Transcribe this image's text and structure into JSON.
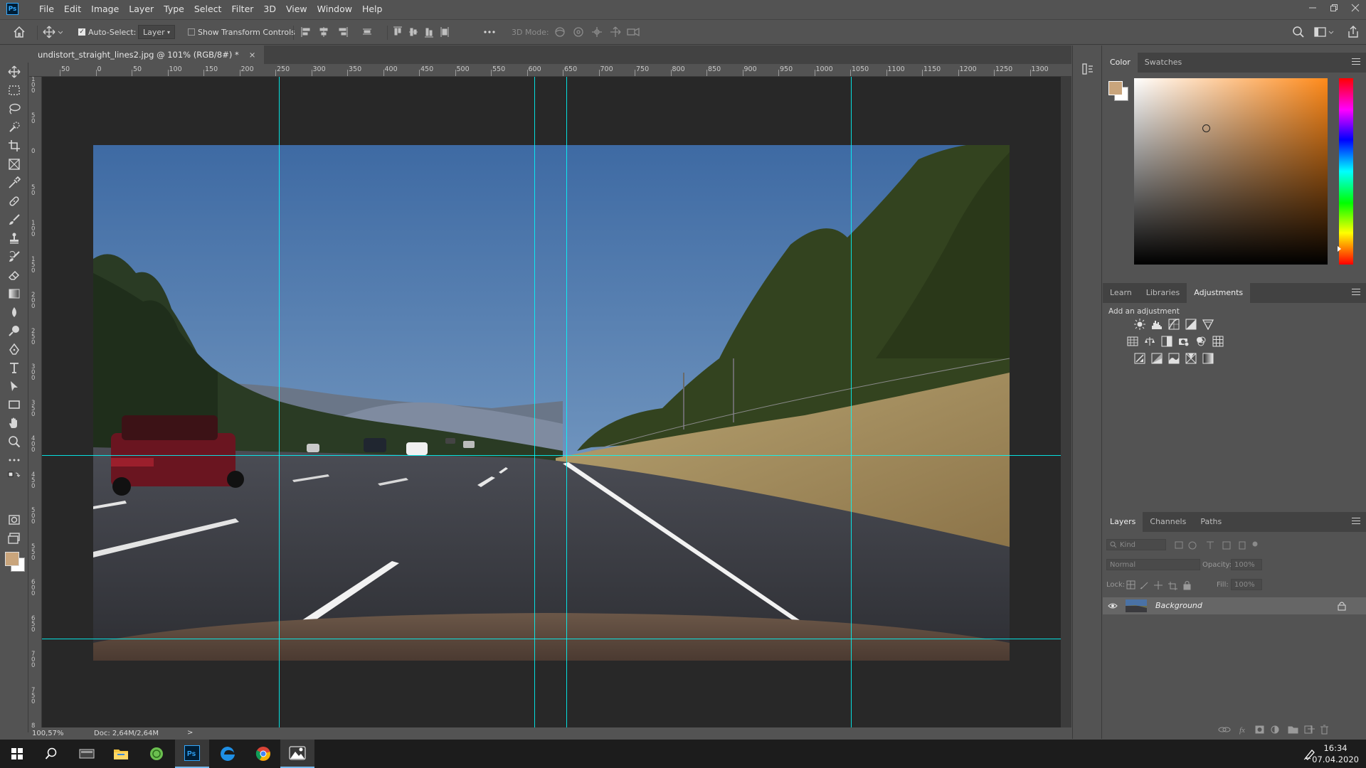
{
  "app": {
    "logo_text": "Ps"
  },
  "menu": [
    "File",
    "Edit",
    "Image",
    "Layer",
    "Type",
    "Select",
    "Filter",
    "3D",
    "View",
    "Window",
    "Help"
  ],
  "options_bar": {
    "auto_select_label": "Auto-Select:",
    "auto_select_checked": true,
    "auto_select_target": "Layer",
    "show_transform_label": "Show Transform Controls",
    "mode_3d_label": "3D Mode:"
  },
  "document": {
    "tab_title": "undistort_straight_lines2.jpg @ 101% (RGB/8#) *",
    "close_glyph": "×",
    "ruler_h_labels": [
      "50",
      "0",
      "50",
      "100",
      "150",
      "200",
      "250",
      "300",
      "350",
      "400",
      "450",
      "500",
      "550",
      "600",
      "650",
      "700",
      "750",
      "800",
      "850",
      "900",
      "950",
      "1000",
      "1050",
      "1100",
      "1150",
      "1200",
      "1250",
      "1300"
    ],
    "ruler_v_labels": [
      "1 0 0",
      "5 0",
      "0",
      "5 0",
      "1 0 0",
      "1 5 0",
      "2 0 0",
      "2 5 0",
      "3 0 0",
      "3 5 0",
      "4 0 0",
      "4 5 0",
      "5 0 0",
      "5 5 0",
      "6 0 0",
      "6 5 0",
      "7 0 0",
      "7 5 0",
      "8"
    ]
  },
  "status": {
    "zoom": "100,57%",
    "doc_info": "Doc: 2,64M/2,64M",
    "arrow": ">"
  },
  "color_panel": {
    "tabs": [
      "Color",
      "Swatches"
    ],
    "active_tab": "Color",
    "foreground_color": "#c9a57c",
    "background_color": "#ffffff",
    "hue_color": "#ff8a1a"
  },
  "adjustments_panel": {
    "tabs": [
      "Learn",
      "Libraries",
      "Adjustments"
    ],
    "active_tab": "Adjustments",
    "heading": "Add an adjustment"
  },
  "layers_panel": {
    "tabs": [
      "Layers",
      "Channels",
      "Paths"
    ],
    "active_tab": "Layers",
    "filter_placeholder": "Kind",
    "blend_mode": "Normal",
    "opacity_label": "Opacity:",
    "opacity_value": "100%",
    "lock_label": "Lock:",
    "fill_label": "Fill:",
    "fill_value": "100%",
    "layers": [
      {
        "name": "Background",
        "visible": true,
        "locked": true
      }
    ]
  },
  "taskbar": {
    "time": "16:34",
    "date": "07.04.2020"
  },
  "colors": {
    "ui_bg": "#535353",
    "pasteboard": "#282828",
    "guide": "#00ffff",
    "accent": "#31a8ff"
  }
}
